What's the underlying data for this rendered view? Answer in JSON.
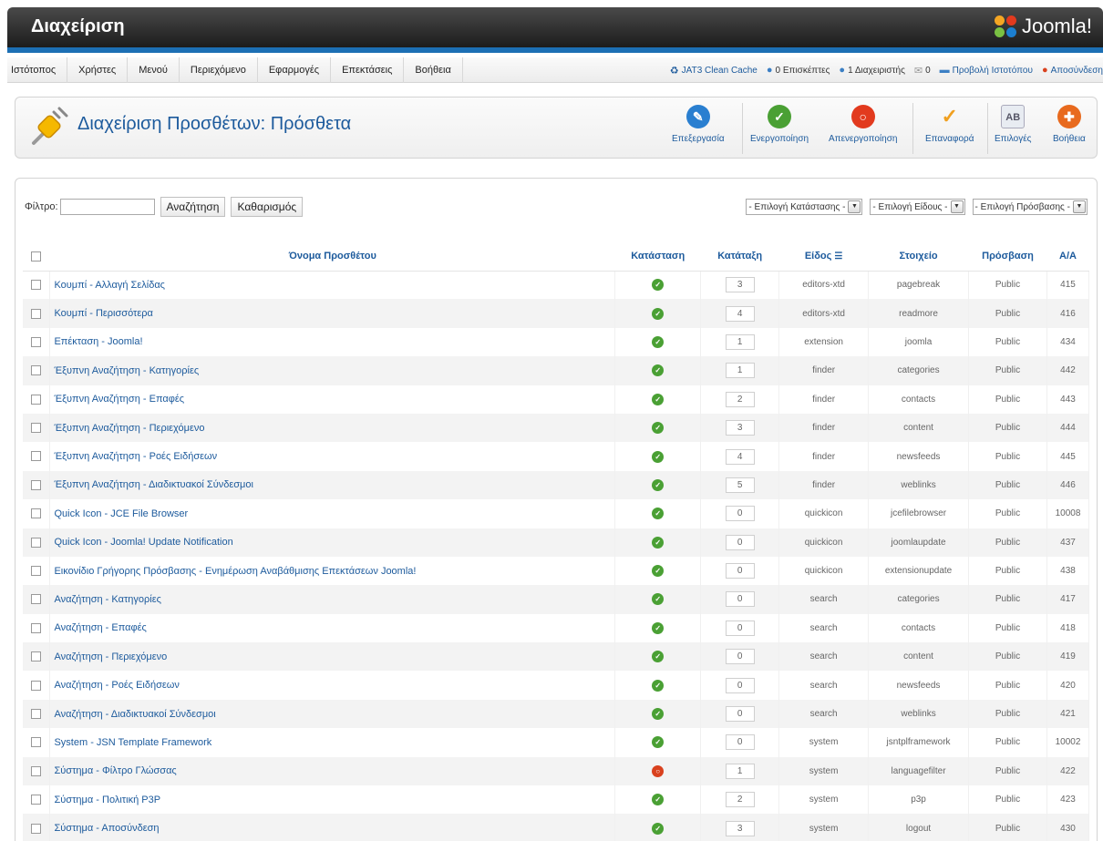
{
  "header": {
    "title": "Διαχείριση",
    "logo_text": "Joomla!"
  },
  "menu": [
    "Ιστότοπος",
    "Χρήστες",
    "Μενού",
    "Περιεχόμενο",
    "Εφαρμογές",
    "Επεκτάσεις",
    "Βοήθεια"
  ],
  "status": {
    "clean_cache": "JAT3 Clean Cache",
    "visitors": "0 Επισκέπτες",
    "admins": "1 Διαχειριστής",
    "messages": "0",
    "view_site": "Προβολή Ιστοτόπου",
    "logout": "Αποσύνδεση"
  },
  "toolbar": {
    "title": "Διαχείριση Προσθέτων: Πρόσθετα",
    "buttons": [
      {
        "label": "Επεξεργασία",
        "icon": "edit-icon",
        "color": "#2a7fd0"
      },
      {
        "label": "Ενεργοποίηση",
        "icon": "check-icon",
        "color": "#4aa034"
      },
      {
        "label": "Απενεργοποίηση",
        "icon": "disable-icon",
        "color": "#e23a1e"
      },
      {
        "label": "Επαναφορά",
        "icon": "checkin-icon",
        "color": "#f0a020"
      },
      {
        "label": "Επιλογές",
        "icon": "options-icon",
        "color": "#8090a8"
      },
      {
        "label": "Βοήθεια",
        "icon": "help-icon",
        "color": "#e86a1e"
      }
    ]
  },
  "filter": {
    "label": "Φίλτρο:",
    "search_value": "",
    "search_button": "Αναζήτηση",
    "clear_button": "Καθαρισμός",
    "selects": [
      "- Επιλογή Κατάστασης -",
      "- Επιλογή Είδους -",
      "- Επιλογή Πρόσβασης -"
    ]
  },
  "table": {
    "columns": {
      "name": "Όνομα Προσθέτου",
      "status": "Κατάσταση",
      "ordering": "Κατάταξη",
      "type": "Είδος",
      "element": "Στοιχείο",
      "access": "Πρόσβαση",
      "id": "Α/Α"
    },
    "rows": [
      {
        "name": "Κουμπί - Αλλαγή Σελίδας",
        "enabled": true,
        "order": "3",
        "type": "editors-xtd",
        "element": "pagebreak",
        "access": "Public",
        "id": "415"
      },
      {
        "name": "Κουμπί - Περισσότερα",
        "enabled": true,
        "order": "4",
        "type": "editors-xtd",
        "element": "readmore",
        "access": "Public",
        "id": "416"
      },
      {
        "name": "Επέκταση - Joomla!",
        "enabled": true,
        "order": "1",
        "type": "extension",
        "element": "joomla",
        "access": "Public",
        "id": "434"
      },
      {
        "name": "Έξυπνη Αναζήτηση - Κατηγορίες",
        "enabled": true,
        "order": "1",
        "type": "finder",
        "element": "categories",
        "access": "Public",
        "id": "442"
      },
      {
        "name": "Έξυπνη Αναζήτηση - Επαφές",
        "enabled": true,
        "order": "2",
        "type": "finder",
        "element": "contacts",
        "access": "Public",
        "id": "443"
      },
      {
        "name": "Έξυπνη Αναζήτηση - Περιεχόμενο",
        "enabled": true,
        "order": "3",
        "type": "finder",
        "element": "content",
        "access": "Public",
        "id": "444"
      },
      {
        "name": "Έξυπνη Αναζήτηση - Ροές Ειδήσεων",
        "enabled": true,
        "order": "4",
        "type": "finder",
        "element": "newsfeeds",
        "access": "Public",
        "id": "445"
      },
      {
        "name": "Έξυπνη Αναζήτηση - Διαδικτυακοί Σύνδεσμοι",
        "enabled": true,
        "order": "5",
        "type": "finder",
        "element": "weblinks",
        "access": "Public",
        "id": "446"
      },
      {
        "name": "Quick Icon - JCE File Browser",
        "enabled": true,
        "order": "0",
        "type": "quickicon",
        "element": "jcefilebrowser",
        "access": "Public",
        "id": "10008"
      },
      {
        "name": "Quick Icon - Joomla! Update Notification",
        "enabled": true,
        "order": "0",
        "type": "quickicon",
        "element": "joomlaupdate",
        "access": "Public",
        "id": "437"
      },
      {
        "name": "Εικονίδιο Γρήγορης Πρόσβασης - Ενημέρωση Αναβάθμισης Επεκτάσεων Joomla!",
        "enabled": true,
        "order": "0",
        "type": "quickicon",
        "element": "extensionupdate",
        "access": "Public",
        "id": "438"
      },
      {
        "name": "Αναζήτηση - Κατηγορίες",
        "enabled": true,
        "order": "0",
        "type": "search",
        "element": "categories",
        "access": "Public",
        "id": "417"
      },
      {
        "name": "Αναζήτηση - Επαφές",
        "enabled": true,
        "order": "0",
        "type": "search",
        "element": "contacts",
        "access": "Public",
        "id": "418"
      },
      {
        "name": "Αναζήτηση - Περιεχόμενο",
        "enabled": true,
        "order": "0",
        "type": "search",
        "element": "content",
        "access": "Public",
        "id": "419"
      },
      {
        "name": "Αναζήτηση - Ροές Ειδήσεων",
        "enabled": true,
        "order": "0",
        "type": "search",
        "element": "newsfeeds",
        "access": "Public",
        "id": "420"
      },
      {
        "name": "Αναζήτηση - Διαδικτυακοί Σύνδεσμοι",
        "enabled": true,
        "order": "0",
        "type": "search",
        "element": "weblinks",
        "access": "Public",
        "id": "421"
      },
      {
        "name": "System - JSN Template Framework",
        "enabled": true,
        "order": "0",
        "type": "system",
        "element": "jsntplframework",
        "access": "Public",
        "id": "10002"
      },
      {
        "name": "Σύστημα - Φίλτρο Γλώσσας",
        "enabled": false,
        "order": "1",
        "type": "system",
        "element": "languagefilter",
        "access": "Public",
        "id": "422"
      },
      {
        "name": "Σύστημα - Πολιτική P3P",
        "enabled": true,
        "order": "2",
        "type": "system",
        "element": "p3p",
        "access": "Public",
        "id": "423"
      },
      {
        "name": "Σύστημα - Αποσύνδεση",
        "enabled": true,
        "order": "3",
        "type": "system",
        "element": "logout",
        "access": "Public",
        "id": "430"
      }
    ]
  },
  "colors": {
    "accent": "#1c5a9c",
    "enabled": "#4aa034",
    "disabled": "#d9411e",
    "header_bar": "#1c6fb4"
  }
}
